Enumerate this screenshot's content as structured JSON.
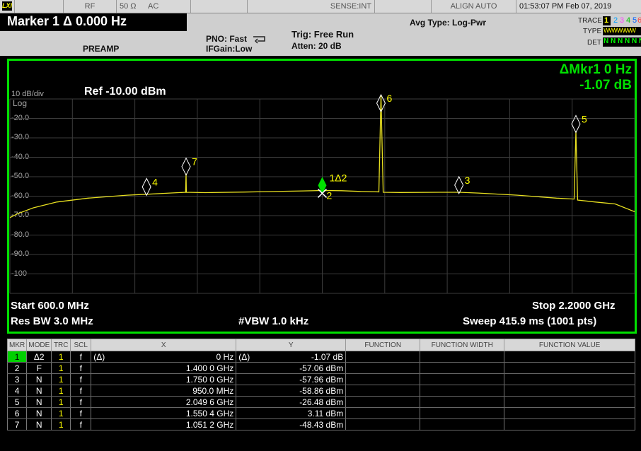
{
  "status_bar": {
    "logo": "LXI",
    "items": [
      "RF",
      "50 Ω",
      "AC",
      "SENSE:INT",
      "ALIGN AUTO",
      "01:53:07 PM Feb 07, 2019"
    ]
  },
  "header": {
    "marker_title": "Marker 1 Δ 0.000 Hz",
    "preamp": "PREAMP",
    "pno": "PNO: Fast",
    "ifgain": "IFGain:Low",
    "trig": "Trig: Free Run",
    "atten": "Atten: 20 dB",
    "avg_type": "Avg Type: Log-Pwr",
    "trace_label": "TRACE",
    "trace_numbers": [
      "1",
      "2",
      "3",
      "4",
      "5",
      "6"
    ],
    "type_label": "TYPE",
    "type_value": "WWWWWW",
    "det_label": "DET",
    "det_value": "N N N N N N"
  },
  "plot": {
    "scale": "10 dB/div",
    "ref": "Ref -10.00 dBm",
    "scale_type": "Log",
    "delta_marker": "ΔMkr1 0 Hz",
    "delta_value": "-1.07 dB",
    "y_ticks": [
      "-20.0",
      "-30.0",
      "-40.0",
      "-50.0",
      "-60.0",
      "-70.0",
      "-80.0",
      "-90.0",
      "-100"
    ],
    "start": "Start 600.0 MHz",
    "stop": "Stop 2.2000 GHz",
    "res_bw": "Res BW 3.0 MHz",
    "vbw": "#VBW 1.0 kHz",
    "sweep": "Sweep  415.9 ms (1001 pts)",
    "marker_labels": [
      "1Δ2",
      "2",
      "3",
      "4",
      "5",
      "6",
      "7"
    ]
  },
  "chart_data": {
    "type": "line",
    "xlabel": "",
    "ylabel": "",
    "x_unit": "GHz",
    "y_unit": "dBm",
    "xlim": [
      0.6,
      2.2
    ],
    "ylim": [
      -110,
      -10
    ],
    "grid": true,
    "series": [
      {
        "x": [
          0.6,
          0.62,
          0.66,
          0.72,
          0.8,
          0.9,
          0.95,
          1.0,
          1.05,
          1.0512,
          1.052,
          1.1,
          1.2,
          1.3,
          1.35,
          1.4,
          1.45,
          1.5,
          1.545,
          1.5504,
          1.556,
          1.6,
          1.7,
          1.75,
          1.8,
          1.9,
          2.0,
          2.045,
          2.0496,
          2.054,
          2.1,
          2.15,
          2.2
        ],
        "y": [
          -71,
          -69,
          -66,
          -63,
          -61,
          -59.5,
          -59,
          -58.5,
          -58,
          -48.4,
          -58,
          -58.2,
          -57.9,
          -57.5,
          -57.3,
          -57.1,
          -57.2,
          -57.6,
          -57.8,
          3.1,
          -58,
          -58.1,
          -58,
          -58,
          -58.4,
          -59.5,
          -61,
          -61.5,
          -26.5,
          -62,
          -63,
          -64,
          -68
        ]
      }
    ],
    "markers": [
      {
        "id": 1,
        "mode": "Δ2",
        "x": 1.4,
        "y": -58.1
      },
      {
        "id": 2,
        "mode": "F",
        "x": 1.4,
        "y": -57.06
      },
      {
        "id": 3,
        "mode": "N",
        "x": 1.75,
        "y": -57.96
      },
      {
        "id": 4,
        "mode": "N",
        "x": 0.95,
        "y": -58.86
      },
      {
        "id": 5,
        "mode": "N",
        "x": 2.0496,
        "y": -26.48
      },
      {
        "id": 6,
        "mode": "N",
        "x": 1.5504,
        "y": 3.11
      },
      {
        "id": 7,
        "mode": "N",
        "x": 1.0512,
        "y": -48.43
      }
    ]
  },
  "table": {
    "headers": [
      "MKR",
      "MODE",
      "TRC",
      "SCL",
      "X",
      "Y",
      "FUNCTION",
      "FUNCTION WIDTH",
      "FUNCTION VALUE"
    ],
    "rows": [
      {
        "mkr": "1",
        "mode": "Δ2",
        "trc": "1",
        "scl": "f",
        "x_prefix": "(Δ)",
        "x": "0 Hz",
        "y_prefix": "(Δ)",
        "y": "-1.07 dB"
      },
      {
        "mkr": "2",
        "mode": "F",
        "trc": "1",
        "scl": "f",
        "x_prefix": "",
        "x": "1.400 0 GHz",
        "y_prefix": "",
        "y": "-57.06 dBm"
      },
      {
        "mkr": "3",
        "mode": "N",
        "trc": "1",
        "scl": "f",
        "x_prefix": "",
        "x": "1.750 0 GHz",
        "y_prefix": "",
        "y": "-57.96 dBm"
      },
      {
        "mkr": "4",
        "mode": "N",
        "trc": "1",
        "scl": "f",
        "x_prefix": "",
        "x": "950.0 MHz",
        "y_prefix": "",
        "y": "-58.86 dBm"
      },
      {
        "mkr": "5",
        "mode": "N",
        "trc": "1",
        "scl": "f",
        "x_prefix": "",
        "x": "2.049 6 GHz",
        "y_prefix": "",
        "y": "-26.48 dBm"
      },
      {
        "mkr": "6",
        "mode": "N",
        "trc": "1",
        "scl": "f",
        "x_prefix": "",
        "x": "1.550 4 GHz",
        "y_prefix": "",
        "y": "3.11 dBm"
      },
      {
        "mkr": "7",
        "mode": "N",
        "trc": "1",
        "scl": "f",
        "x_prefix": "",
        "x": "1.051 2 GHz",
        "y_prefix": "",
        "y": "-48.43 dBm"
      }
    ]
  },
  "colors": {
    "trace": "#e8e020",
    "accent": "#00e000",
    "marker_active": "#00e000",
    "background": "#000000"
  }
}
